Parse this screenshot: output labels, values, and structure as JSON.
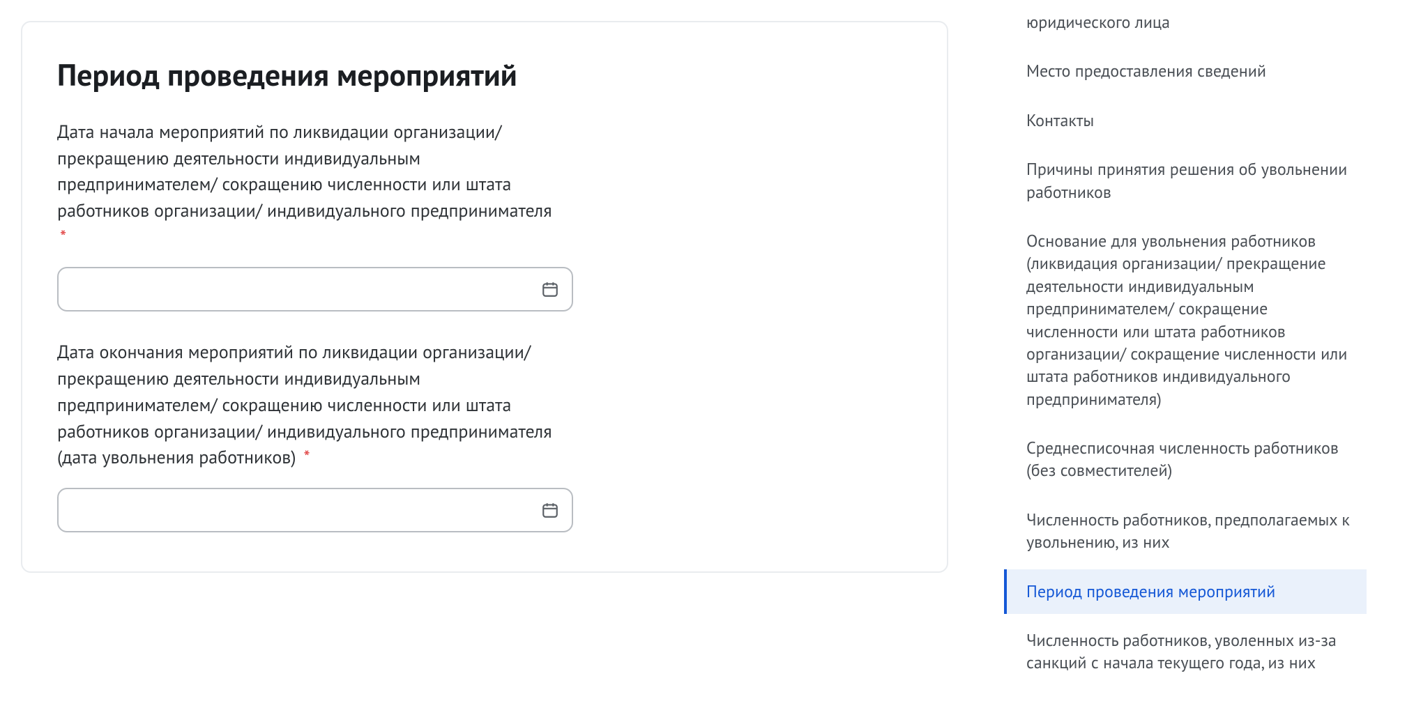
{
  "main": {
    "heading": "Период проведения мероприятий",
    "fields": [
      {
        "label": "Дата начала мероприятий по ликвидации организации/ прекращению деятельности индивидуальным предпринимателем/ сокращению численности или штата работников организации/ индивидуального предпринимателя",
        "required_mark": "*",
        "value": ""
      },
      {
        "label": "Дата окончания мероприятий по ликвидации организации/ прекращению деятельности индивидуальным предпринимателем/ сокращению численности или штата работников организации/ индивидуального предпринимателя (дата увольнения работников)",
        "required_mark": "*",
        "value": ""
      }
    ]
  },
  "sidenav": {
    "items": [
      {
        "label": "юридического лица",
        "active": false
      },
      {
        "label": "Место предоставления сведений",
        "active": false
      },
      {
        "label": "Контакты",
        "active": false
      },
      {
        "label": "Причины принятия решения об увольнении работников",
        "active": false
      },
      {
        "label": "Основание для увольнения работников (ликвидация организации/ прекращение деятельности индивидуальным предпринимателем/ сокращение численности или штата работников организации/ сокращение численности или штата работников индивидуального предпринимателя)",
        "active": false
      },
      {
        "label": "Среднесписочная численность работников (без совместителей)",
        "active": false
      },
      {
        "label": "Численность работников, предполагаемых к увольнению, из них",
        "active": false
      },
      {
        "label": "Период проведения мероприятий",
        "active": true
      },
      {
        "label": "Численность работников, уволенных из-за санкций с начала текущего года, из них",
        "active": false
      }
    ]
  }
}
